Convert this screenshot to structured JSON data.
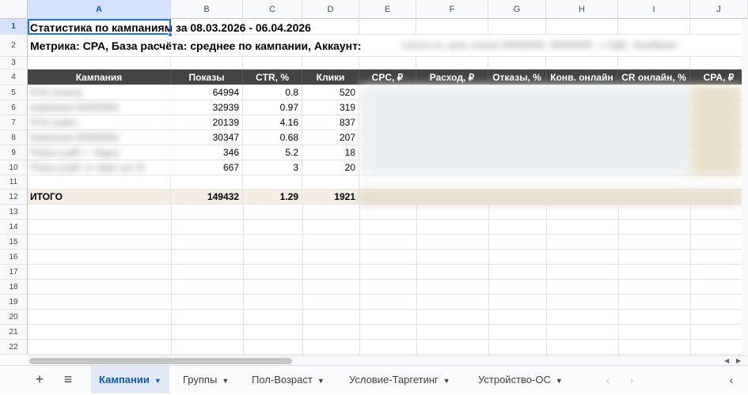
{
  "columns": [
    "A",
    "B",
    "C",
    "D",
    "E",
    "F",
    "G",
    "H",
    "I",
    "J"
  ],
  "rows": [
    "1",
    "2",
    "3",
    "4",
    "5",
    "6",
    "7",
    "8",
    "9",
    "10",
    "11",
    "12",
    "13",
    "14",
    "15",
    "16",
    "17",
    "18",
    "19",
    "20",
    "21",
    "22"
  ],
  "title": "Статистика по кампаниям за 08.03.2026 - 06.04.2026",
  "subtitle": "Метрика: CPA, База расчёта: среднее по кампании, Аккаунт:",
  "subtitle_blurred": "xxxxxx-xx, цель xxxxxx 00000000, 00000000 - c НДС, Агрейшин",
  "table_headers": [
    "Кампания",
    "Показы",
    "CTR, %",
    "Клики",
    "CPC, ₽",
    "Расход, ₽",
    "Отказы, %",
    "Конв. онлайн",
    "CR онлайн, %",
    "CPA, ₽"
  ],
  "table_rows": [
    {
      "name": "РСК (поиск)",
      "shows": "64994",
      "ctr": "0.8",
      "clicks": "520"
    },
    {
      "name": "Кампания 00000000",
      "shows": "32939",
      "ctr": "0.97",
      "clicks": "319"
    },
    {
      "name": "РСК (сайт)",
      "shows": "20139",
      "ctr": "4.16",
      "clicks": "837"
    },
    {
      "name": "Кампания 00000000",
      "shows": "30347",
      "ctr": "0.68",
      "clicks": "207"
    },
    {
      "name": "Поиск (сайт + лиды)",
      "shows": "346",
      "ctr": "5.2",
      "clicks": "18"
    },
    {
      "name": "Поиск (сайт от ммм суп 0)",
      "shows": "667",
      "ctr": "3",
      "clicks": "20"
    }
  ],
  "total": {
    "label": "ИТОГО",
    "shows": "149432",
    "ctr": "1.29",
    "clicks": "1921"
  },
  "tabs": [
    {
      "label": "Кампании",
      "active": true
    },
    {
      "label": "Группы",
      "active": false
    },
    {
      "label": "Пол-Возраст",
      "active": false
    },
    {
      "label": "Условие-Таргетинг",
      "active": false
    },
    {
      "label": "Устройство-ОС",
      "active": false
    }
  ],
  "tabbar": {
    "add": "+",
    "list": "≡",
    "prev": "‹",
    "next": "›",
    "collapse": "‹"
  },
  "colors": {
    "header_bg": "#444444",
    "total_bg": "#f3ede3",
    "accent": "#0b57d0"
  }
}
